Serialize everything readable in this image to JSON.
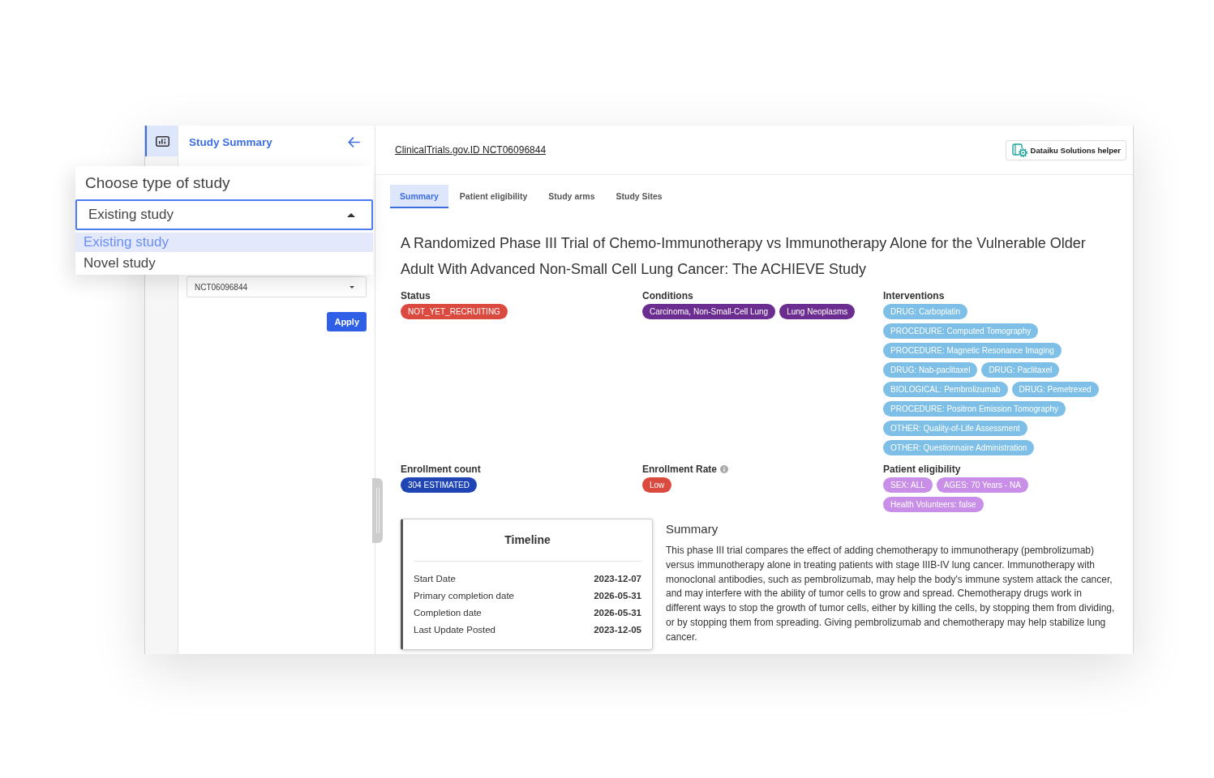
{
  "sidebar": {
    "rail": [
      {
        "selected": true
      }
    ],
    "title": "Study Summary",
    "study_select": {
      "value": "NCT06096844"
    },
    "apply_button": "Apply"
  },
  "study_type_dropdown": {
    "label": "Choose type of study",
    "value": "Existing study",
    "expanded": true,
    "options": [
      {
        "label": "Existing study",
        "selected": true
      },
      {
        "label": "Novel study",
        "selected": false
      }
    ]
  },
  "header": {
    "link": "ClinicalTrials.gov.ID NCT06096844",
    "helper_button": "Dataiku Solutions helper"
  },
  "tabs": [
    {
      "label": "Summary",
      "selected": true
    },
    {
      "label": "Patient eligibility",
      "selected": false
    },
    {
      "label": "Study arms",
      "selected": false
    },
    {
      "label": "Study Sites",
      "selected": false
    }
  ],
  "study": {
    "title": "A Randomized Phase III Trial of Chemo-Immunotherapy vs Immunotherapy Alone for the Vulnerable Older Adult With Advanced Non-Small Cell Lung Cancer: The ACHIEVE Study",
    "sections": [
      {
        "heading": "Status",
        "color": "#db4a3f",
        "tags": [
          "NOT_YET_RECRUITING"
        ]
      },
      {
        "heading": "Conditions",
        "color": "#6b2d90",
        "tags": [
          "Carcinoma, Non-Small-Cell Lung",
          "Lung Neoplasms"
        ]
      },
      {
        "heading": "Interventions",
        "color": "#7dbfe7",
        "tags": [
          "DRUG: Carboplatin",
          "PROCEDURE: Computed Tomography",
          "PROCEDURE: Magnetic Resonance Imaging",
          "DRUG: Nab-paclitaxel",
          "DRUG: Paclitaxel",
          "BIOLOGICAL: Pembrolizumab",
          "DRUG: Pemetrexed",
          "PROCEDURE: Positron Emission Tomography",
          "OTHER: Quality-of-Life Assessment",
          "OTHER: Questionnaire Administration"
        ]
      },
      {
        "heading": "Enrollment count",
        "color": "#1f45b5",
        "tags": [
          "304 ESTIMATED"
        ]
      },
      {
        "heading": "Enrollment Rate",
        "info": true,
        "color": "#db4a3f",
        "tags": [
          "Low"
        ]
      },
      {
        "heading": "Patient eligibility",
        "color": "#c98fe8",
        "tags": [
          "SEX: ALL",
          "AGES: 70 Years - NA",
          "Health Volunteers: false"
        ]
      }
    ]
  },
  "timeline": {
    "title": "Timeline",
    "rows": [
      {
        "label": "Start Date",
        "value": "2023-12-07"
      },
      {
        "label": "Primary completion date",
        "value": "2026-05-31"
      },
      {
        "label": "Completion date",
        "value": "2026-05-31"
      },
      {
        "label": "Last Update Posted",
        "value": "2023-12-05"
      }
    ]
  },
  "summary": {
    "heading": "Summary",
    "text": "This phase III trial compares the effect of adding chemotherapy to immunotherapy (pembrolizumab) versus immunotherapy alone in treating patients with stage IIIB-IV lung cancer. Immunotherapy with monoclonal antibodies, such as pembrolizumab, may help the body's immune system attack the cancer, and may interfere with the ability of tumor cells to grow and spread. Chemotherapy drugs work in different ways to stop the growth of tumor cells, either by killing the cells, by stopping them from dividing, or by stopping them from spreading. Giving pembrolizumab and chemotherapy may help stabilize lung cancer."
  }
}
